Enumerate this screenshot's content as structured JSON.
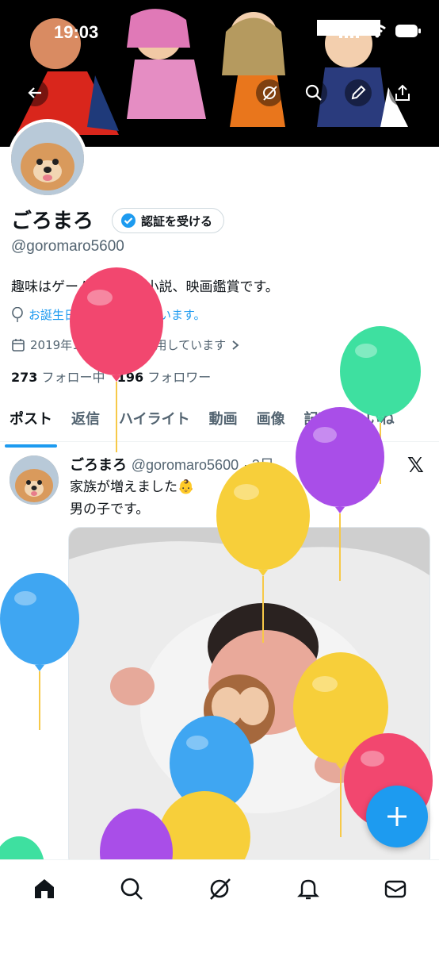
{
  "status_bar": {
    "time": "19:03"
  },
  "profile": {
    "name": "ごろまろ",
    "verify_label": "認証を受ける",
    "handle": "@goromaro5600",
    "bio": "趣味はゲーム、漫画、小説、映画鑑賞です。",
    "birthday_text": "お誕生日おめでとうございます。",
    "joined_text": "2019年10月からXを利用しています",
    "following_count": "273",
    "following_label": "フォロー中",
    "followers_count": "196",
    "followers_label": "フォロワー"
  },
  "tabs": [
    {
      "label": "ポスト"
    },
    {
      "label": "返信"
    },
    {
      "label": "ハイライト"
    },
    {
      "label": "動画"
    },
    {
      "label": "画像"
    },
    {
      "label": "記事"
    },
    {
      "label": "いいね"
    }
  ],
  "post": {
    "author": "ごろまろ",
    "handle": "@goromaro5600",
    "time": "· 3日",
    "line1": "家族が増えました👶",
    "line2": "男の子です。"
  },
  "colors": {
    "accent": "#1d9bf0",
    "balloon_red": "#f2476f",
    "balloon_green": "#3ee0a0",
    "balloon_purple": "#a94ee8",
    "balloon_yellow": "#f7cf3a",
    "balloon_blue": "#3fa6f2"
  },
  "icons": {
    "back": "back-arrow-icon",
    "grok": "grok-icon",
    "search": "search-icon",
    "edit": "edit-pencil-icon",
    "share": "share-icon",
    "verified": "verified-badge-icon",
    "birthday": "balloon-icon",
    "calendar": "calendar-icon",
    "fab": "plus-icon",
    "nav": [
      "home-icon",
      "search-icon",
      "grok-icon",
      "bell-icon",
      "mail-icon"
    ]
  }
}
